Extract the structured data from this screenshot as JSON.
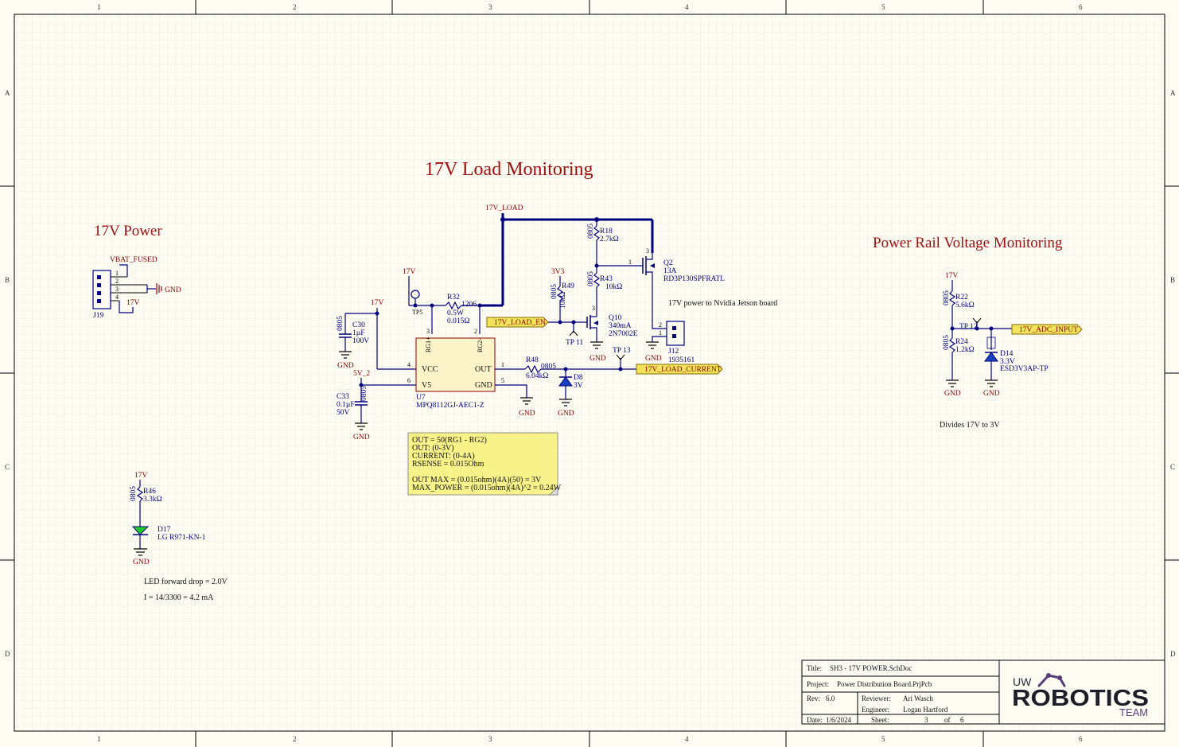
{
  "zones": {
    "columns": [
      "1",
      "2",
      "3",
      "4",
      "5",
      "6"
    ],
    "rows": [
      "A",
      "B",
      "C",
      "D"
    ]
  },
  "headings": {
    "load_monitoring": "17V Load Monitoring",
    "power": "17V Power",
    "rail_monitoring": "Power Rail Voltage Monitoring"
  },
  "notes": {
    "jetson": "17V power to Nvidia Jetson board",
    "divides": "Divides 17V to 3V",
    "led_drop": "LED forward drop = 2.0V",
    "led_current": "I = 14/3300 = 4.2 mA"
  },
  "formula_note": [
    "OUT = 50(RG1 - RG2)",
    "OUT: (0-3V)",
    "CURRENT: (0-4A)",
    "RSENSE = 0.015Ohm",
    "",
    "OUT MAX = (0.015ohm)(4A)(50) = 3V",
    "MAX_POWER = (0.015ohm)(4A)^2 = 0.24W"
  ],
  "nets": {
    "vbat_fused": "VBAT_FUSED",
    "gnd": "GND",
    "v17": "17V",
    "v17_load": "17V_LOAD",
    "v3v3": "3V3",
    "v5v2": "5V_2",
    "load_en": "17V_LOAD_EN",
    "load_current": "17V_LOAD_CURRENT",
    "adc_input": "17V_ADC_INPUT"
  },
  "components": {
    "j19": {
      "ref": "J19",
      "pins": [
        "1",
        "2",
        "3",
        "4"
      ]
    },
    "r32": {
      "ref": "R32",
      "pkg": "1206",
      "v1": "0.5W",
      "v2": "0.015Ω"
    },
    "tp5": {
      "ref": "TP5"
    },
    "c30": {
      "ref": "C30",
      "pkg": "0805",
      "v1": "1µF",
      "v2": "100V"
    },
    "c33": {
      "ref": "C33",
      "pkg": "0805",
      "v1": "0.1µF",
      "v2": "50V"
    },
    "u7": {
      "ref": "U7",
      "part": "MPQ8112GJ-AEC1-Z",
      "pins": {
        "rg1": "RG1+",
        "rg2": "RG2-",
        "vcc": "VCC",
        "v5": "V5",
        "out": "OUT",
        "gnd": "GND"
      },
      "pinnums": {
        "p3": "3",
        "p2": "2",
        "p4": "4",
        "p6": "6",
        "p1": "1",
        "p5": "5"
      }
    },
    "r48": {
      "ref": "R48",
      "pkg": "0805",
      "v1": "6.04kΩ"
    },
    "d8": {
      "ref": "D8",
      "v1": "3V"
    },
    "r18": {
      "ref": "R18",
      "pkg": "0805",
      "v1": "2.7kΩ"
    },
    "r43": {
      "ref": "R43",
      "pkg": "0805",
      "v1": "10kΩ"
    },
    "r49": {
      "ref": "R49",
      "pkg": "0805",
      "v1": "10kΩ"
    },
    "q2": {
      "ref": "Q2",
      "v1": "13A",
      "part": "RD3P130SPFRATL"
    },
    "q10": {
      "ref": "Q10",
      "v1": "340mA",
      "part": "2N7002E"
    },
    "j12": {
      "ref": "J12",
      "part": "1935161"
    },
    "tp11": {
      "ref": "TP 11"
    },
    "tp13": {
      "ref": "TP 13"
    },
    "tp12": {
      "ref": "TP 12"
    },
    "r22": {
      "ref": "R22",
      "pkg": "0805",
      "v1": "5.6kΩ"
    },
    "r24": {
      "ref": "R24",
      "pkg": "0805",
      "v1": "1.2kΩ"
    },
    "d14": {
      "ref": "D14",
      "v1": "3.3V",
      "part": "ESD3V3AP-TP"
    },
    "r46": {
      "ref": "R46",
      "pkg": "0805",
      "v1": "3.3kΩ"
    },
    "d17": {
      "ref": "D17",
      "part": "LG R971-KN-1"
    }
  },
  "title_block": {
    "title_label": "Title:",
    "title": "SH3 - 17V POWER.SchDoc",
    "project_label": "Project:",
    "project": "Power Distribution Board.PrjPcb",
    "rev_label": "Rev:",
    "rev": "6.0",
    "reviewer_label": "Reviewer:",
    "reviewer": "Ari Wasch",
    "engineer_label": "Engineer:",
    "engineer": "Logan Hartford",
    "date_label": "Date:",
    "date": "1/6/2024",
    "sheet_label": "Sheet:",
    "sheet": "3",
    "of_label": "of",
    "sheets": "6",
    "logo_uw": "UW",
    "logo_main": "ROBOTICS",
    "logo_team": "TEAM"
  },
  "colors": {
    "wire": "#000080",
    "heading": "#a01010",
    "net": "#8b0000",
    "note_bg": "#f7f28a",
    "netport": "#f2e35c",
    "led": "#22cc22"
  }
}
